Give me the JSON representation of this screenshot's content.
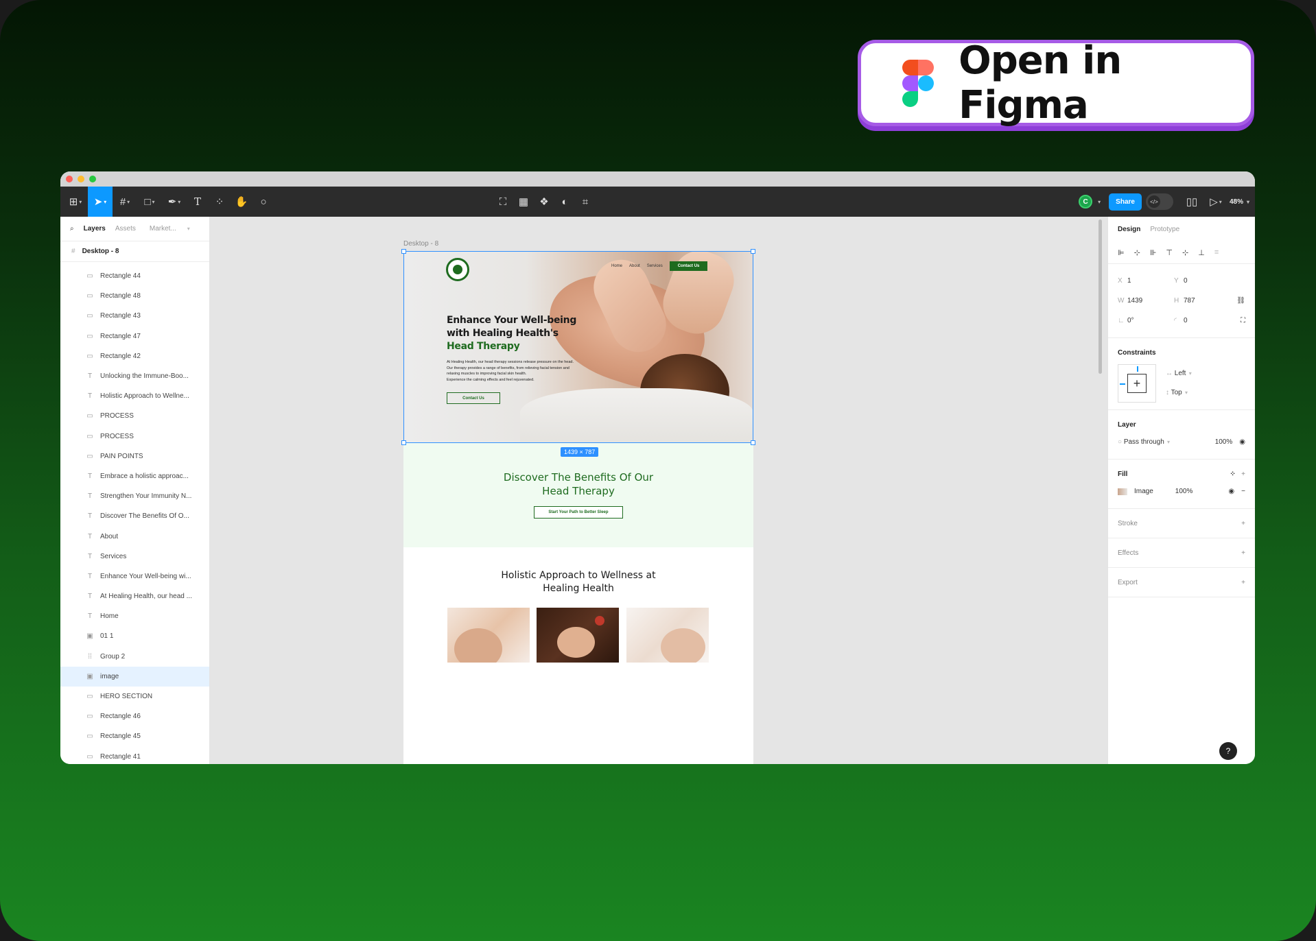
{
  "badge": {
    "text": "Open in Figma"
  },
  "toolbar": {
    "avatar_initial": "C",
    "share_label": "Share",
    "zoom_label": "48%",
    "dev_mode_label": "</>"
  },
  "left_panel": {
    "tabs": [
      "Layers",
      "Assets",
      "Market..."
    ],
    "frame_name": "Desktop - 8",
    "layers": [
      {
        "icon": "rect",
        "name": "Rectangle 44"
      },
      {
        "icon": "rect",
        "name": "Rectangle 48"
      },
      {
        "icon": "rect",
        "name": "Rectangle 43"
      },
      {
        "icon": "rect",
        "name": "Rectangle 47"
      },
      {
        "icon": "rect",
        "name": "Rectangle 42"
      },
      {
        "icon": "text",
        "name": "Unlocking the Immune-Boo..."
      },
      {
        "icon": "text",
        "name": "Holistic Approach to Wellne..."
      },
      {
        "icon": "rect",
        "name": "PROCESS"
      },
      {
        "icon": "rect",
        "name": "PROCESS"
      },
      {
        "icon": "rect",
        "name": "PAIN POINTS"
      },
      {
        "icon": "text",
        "name": "Embrace a holistic approac..."
      },
      {
        "icon": "text",
        "name": "Strengthen Your Immunity N..."
      },
      {
        "icon": "text",
        "name": "Discover The Benefits Of O..."
      },
      {
        "icon": "text",
        "name": "About"
      },
      {
        "icon": "text",
        "name": "Services"
      },
      {
        "icon": "text",
        "name": "Enhance Your Well-being wi..."
      },
      {
        "icon": "text",
        "name": "At Healing Health, our head ..."
      },
      {
        "icon": "text",
        "name": "Home"
      },
      {
        "icon": "img",
        "name": "01 1"
      },
      {
        "icon": "group",
        "name": "Group 2"
      },
      {
        "icon": "img",
        "name": "image",
        "selected": true
      },
      {
        "icon": "rect",
        "name": "HERO SECTION"
      },
      {
        "icon": "rect",
        "name": "Rectangle 46"
      },
      {
        "icon": "rect",
        "name": "Rectangle 45"
      },
      {
        "icon": "rect",
        "name": "Rectangle 41"
      }
    ]
  },
  "right_panel": {
    "tabs": [
      "Design",
      "Prototype"
    ],
    "x": "1",
    "y": "0",
    "w": "1439",
    "h": "787",
    "rotation": "0°",
    "radius": "0",
    "constraints_title": "Constraints",
    "constraint_h": "Left",
    "constraint_v": "Top",
    "layer_title": "Layer",
    "blend_mode": "Pass through",
    "layer_opacity": "100%",
    "fill_title": "Fill",
    "fill_type": "Image",
    "fill_opacity": "100%",
    "stroke_title": "Stroke",
    "effects_title": "Effects",
    "export_title": "Export"
  },
  "canvas": {
    "frame_label": "Desktop - 8",
    "dimensions_badge": "1439 × 787",
    "nav": [
      "Home",
      "About",
      "Services"
    ],
    "nav_cta": "Contact Us",
    "hero_title_1": "Enhance Your Well-being",
    "hero_title_2": "with Healing Health's",
    "hero_title_3": "Head Therapy",
    "hero_body_1": "At Healing Health, our head therapy sessions release pressure on the head.",
    "hero_body_2": "Our therapy provides a range of benefits, from relieving facial tension and",
    "hero_body_3": "relaxing muscles to improving facial skin health.",
    "hero_body_4": "Experience the calming effects and feel rejuvenated.",
    "hero_cta": "Contact Us",
    "benefits_title_1": "Discover The Benefits Of Our",
    "benefits_title_2": "Head Therapy",
    "benefits_cta": "Start Your Path to Better Sleep",
    "holistic_title_1": "Holistic Approach to Wellness at",
    "holistic_title_2": "Healing Health"
  },
  "colors": {
    "accent": "#2e90ff",
    "brand_green": "#1e6b1f",
    "badge_border": "#a65be6"
  }
}
